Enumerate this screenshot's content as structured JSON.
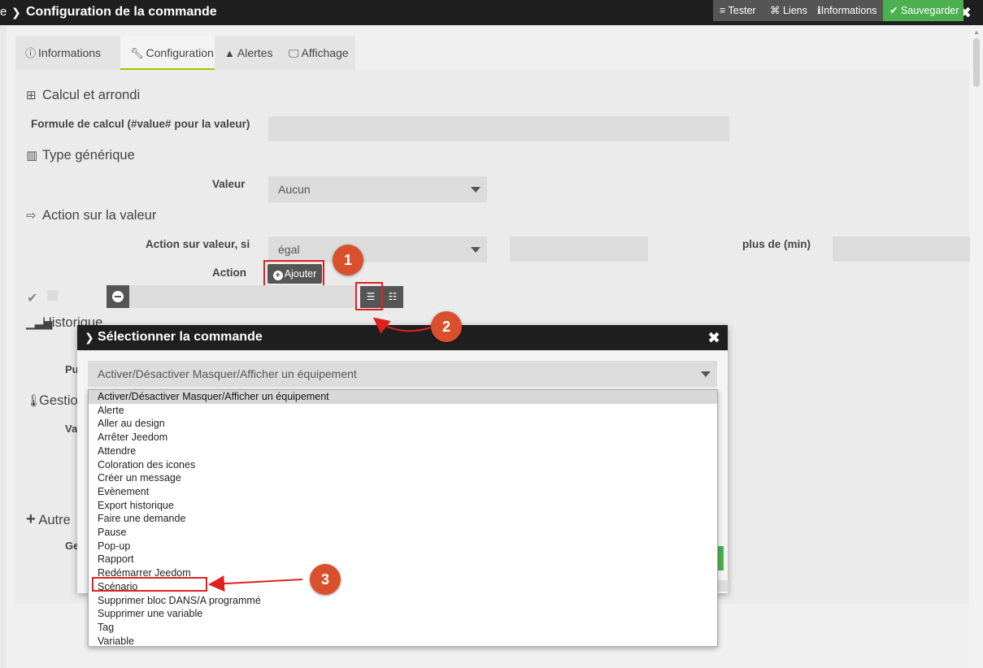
{
  "window": {
    "title": "Configuration de la commande",
    "left_edge_glyph": "e"
  },
  "tabs": [
    {
      "label": "Informations",
      "icon": "info-circle-icon"
    },
    {
      "label": "Configuration",
      "icon": "wrench-icon",
      "active": true
    },
    {
      "label": "Alertes",
      "icon": "warning-icon"
    },
    {
      "label": "Affichage",
      "icon": "monitor-icon"
    }
  ],
  "toolbar": {
    "tester": "Tester",
    "liens": "Liens",
    "informations": "Informations",
    "sauvegarder": "Sauvegarder"
  },
  "sections": {
    "calcul": "Calcul et arrondi",
    "type": "Type générique",
    "action": "Action sur la valeur",
    "historique": "Historique",
    "gestion": "Gestio",
    "autres": "Autre"
  },
  "form": {
    "formule_label": "Formule de calcul (#value# pour la valeur)",
    "valeur_label": "Valeur",
    "valeur_value": "Aucun",
    "action_si_label": "Action sur valeur, si",
    "action_si_value": "égal",
    "plus_de_label": "plus de (min)",
    "action_label": "Action",
    "ajouter": "Ajouter",
    "behind_pu": "Pu",
    "behind_va": "Va",
    "behind_ge": "Ge"
  },
  "modal": {
    "title": "Sélectionner la commande",
    "selected": "Activer/Désactiver Masquer/Afficher un équipement",
    "options": [
      "Activer/Désactiver Masquer/Afficher un équipement",
      "Alerte",
      "Aller au design",
      "Arrêter Jeedom",
      "Attendre",
      "Coloration des icones",
      "Créer un message",
      "Evènement",
      "Export historique",
      "Faire une demande",
      "Pause",
      "Pop-up",
      "Rapport",
      "Redémarrer Jeedom",
      "Scénario",
      "Supprimer bloc DANS/A programmé",
      "Supprimer une variable",
      "Tag",
      "Variable"
    ]
  },
  "annotations": {
    "badge1": "1",
    "badge2": "2",
    "badge3": "3"
  },
  "colors": {
    "accent_green": "#4caf50",
    "annotation_red": "#e02020",
    "badge_orange": "#d9512c",
    "header_dark": "#1f1f1f"
  }
}
